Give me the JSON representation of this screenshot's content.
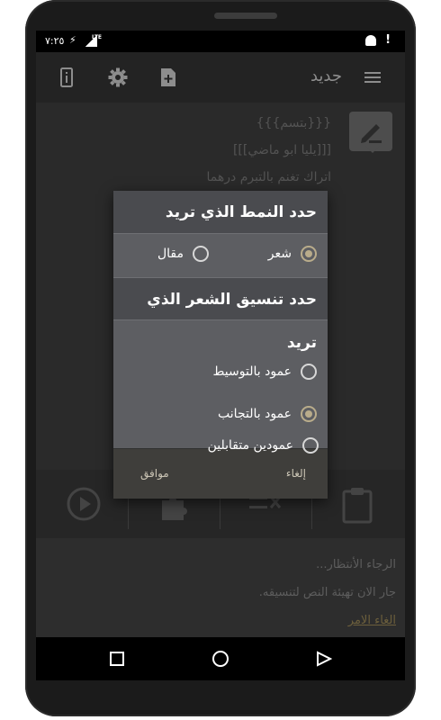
{
  "status_bar": {
    "time": "٧:٢٥",
    "network": "LTE"
  },
  "app_bar": {
    "title": "جديد",
    "icons": [
      "info-icon",
      "gear-icon",
      "add-file-icon",
      "menu-icon"
    ]
  },
  "editor": {
    "lines": [
      "{{{بتسم}}}",
      "[[[يليا ابو ماضي]]]",
      "اتراك تغنم بالتبرم درهما"
    ]
  },
  "toolbar": {
    "icons": [
      "play-icon",
      "puzzle-icon",
      "clear-format-icon",
      "clipboard-icon"
    ]
  },
  "log": {
    "line1": "الرجاء الأنتظار...",
    "line2": "جار الان تهيئة النص لتنسيقه.",
    "cancel_link": "الغاء الامر"
  },
  "dialog": {
    "section1_title": "حدد النمط الذي تريد",
    "section1_options": [
      {
        "label": "شعر",
        "selected": true
      },
      {
        "label": "مقال",
        "selected": false
      }
    ],
    "section2_title": "حدد تنسيق الشعر الذي تريد",
    "section2_options": [
      {
        "label": "عمود بالتوسيط",
        "selected": false
      },
      {
        "label": "عمود بالتجانب",
        "selected": true
      },
      {
        "label": "عمودين متقابلين",
        "selected": false
      }
    ],
    "cancel_label": "إلغاء",
    "ok_label": "موافق"
  },
  "colors": {
    "accent_radio": "#b9ac8b",
    "dialog_bg": "#5d5e62",
    "appbar_bg": "#232323"
  }
}
